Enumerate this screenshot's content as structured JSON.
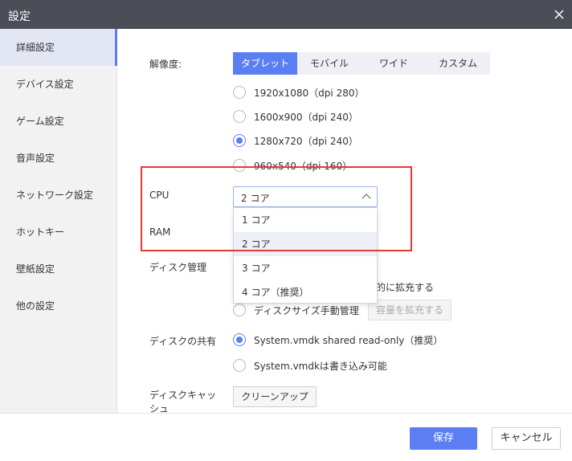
{
  "window": {
    "title": "設定"
  },
  "sidebar": {
    "items": [
      {
        "label": "詳細設定",
        "active": true
      },
      {
        "label": "デバイス設定"
      },
      {
        "label": "ゲーム設定"
      },
      {
        "label": "音声設定"
      },
      {
        "label": "ネットワーク設定"
      },
      {
        "label": "ホットキー"
      },
      {
        "label": "壁紙設定"
      },
      {
        "label": "他の設定"
      }
    ]
  },
  "resolution": {
    "label": "解像度:",
    "tabs": [
      "タブレット",
      "モバイル",
      "ワイド",
      "カスタム"
    ],
    "active_tab": "タブレット",
    "options": [
      "1920x1080（dpi 280）",
      "1600x900（dpi 240）",
      "1280x720（dpi 240）",
      "960x540（dpi 160）"
    ],
    "selected": "1280x720（dpi 240）"
  },
  "cpu": {
    "label": "CPU",
    "value": "2 コア",
    "options": [
      "1 コア",
      "2 コア",
      "3 コア",
      "4 コア（推奨）"
    ]
  },
  "ram": {
    "label": "RAM"
  },
  "disk": {
    "label": "ディスク管理",
    "auto_partial": "的に拡充する",
    "manual": "ディスクサイズ手動管理",
    "expand_button": "容量を拡充する"
  },
  "share": {
    "label": "ディスクの共有",
    "options": [
      "System.vmdk shared read-only（推奨）",
      "System.vmdkは書き込み可能"
    ],
    "selected": "System.vmdk shared read-only（推奨）"
  },
  "cache": {
    "label": "ディスクキャッシュ",
    "button": "クリーンアップ"
  },
  "footer": {
    "save": "保存",
    "cancel": "キャンセル"
  },
  "colors": {
    "accent": "#5b7ff2",
    "titlebar": "#4b4e57",
    "highlight": "#e53935"
  }
}
